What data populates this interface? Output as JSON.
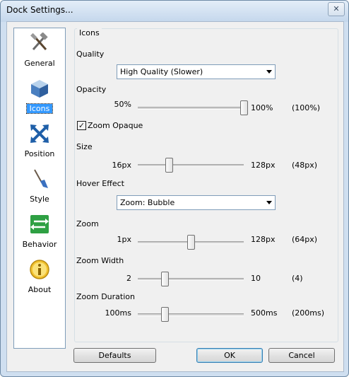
{
  "window": {
    "title": "Dock Settings...",
    "close_glyph": "✕"
  },
  "sidebar": {
    "items": [
      {
        "label": "General",
        "icon": "hammer-wrench-icon",
        "selected": false
      },
      {
        "label": "Icons",
        "icon": "cube-icon",
        "selected": true
      },
      {
        "label": "Position",
        "icon": "move-arrows-icon",
        "selected": false
      },
      {
        "label": "Style",
        "icon": "paintbrush-icon",
        "selected": false
      },
      {
        "label": "Behavior",
        "icon": "exchange-arrows-icon",
        "selected": false
      },
      {
        "label": "About",
        "icon": "info-icon",
        "selected": false
      }
    ]
  },
  "panel": {
    "group_title": "Icons",
    "quality": {
      "label": "Quality",
      "value": "High Quality (Slower)"
    },
    "opacity": {
      "label": "Opacity",
      "min": "50%",
      "max": "100%",
      "current": "(100%)",
      "level": 1.0
    },
    "zoom_opaque": {
      "label": "Zoom Opaque",
      "checked": true,
      "check_glyph": "✓"
    },
    "size": {
      "label": "Size",
      "min": "16px",
      "max": "128px",
      "current": "(48px)",
      "level": 0.29
    },
    "hover_effect": {
      "label": "Hover Effect",
      "value": "Zoom: Bubble"
    },
    "zoom": {
      "label": "Zoom",
      "min": "1px",
      "max": "128px",
      "current": "(64px)",
      "level": 0.5
    },
    "zoom_width": {
      "label": "Zoom Width",
      "min": "2",
      "max": "10",
      "current": "(4)",
      "level": 0.25
    },
    "zoom_duration": {
      "label": "Zoom Duration",
      "min": "100ms",
      "max": "500ms",
      "current": "(200ms)",
      "level": 0.25
    }
  },
  "buttons": {
    "defaults": "Defaults",
    "ok": "OK",
    "cancel": "Cancel"
  },
  "colors": {
    "selection": "#3399ff",
    "window_frame": "#cfdff0"
  }
}
